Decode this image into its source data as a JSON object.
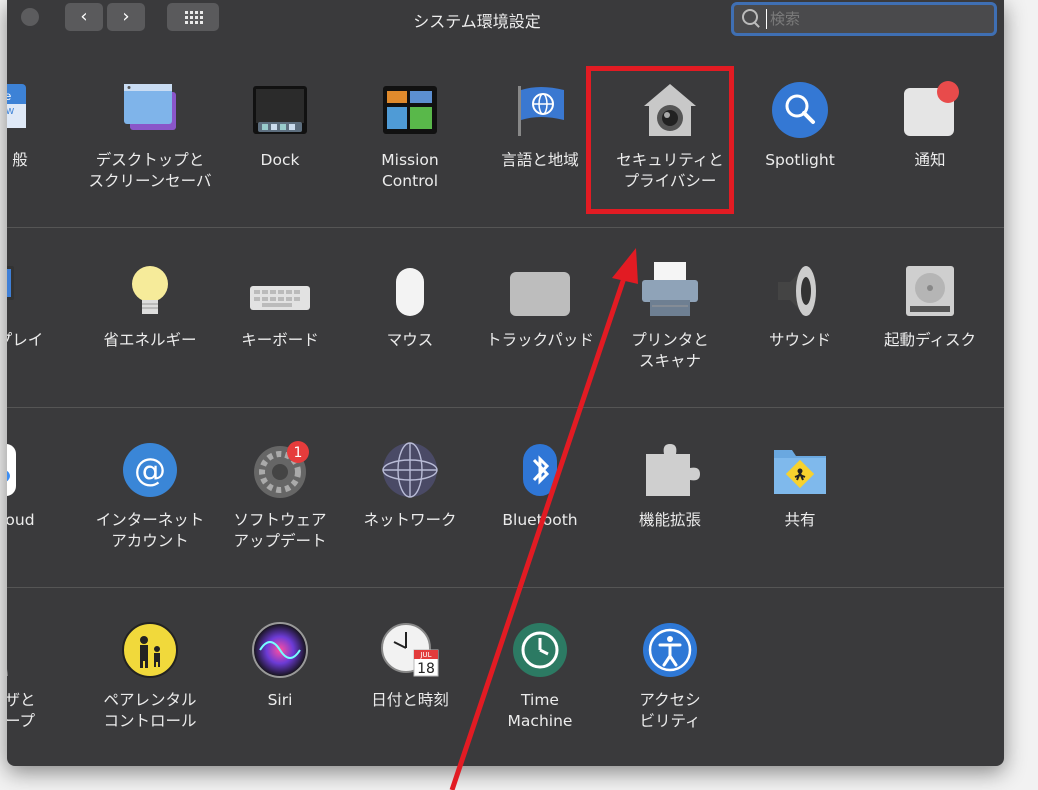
{
  "window": {
    "title": "システム環境設定"
  },
  "toolbar": {
    "back": "‹",
    "forward": "›",
    "search_placeholder": "検索"
  },
  "rows": [
    {
      "items": [
        {
          "id": "general",
          "label": "般",
          "icon": "general-icon"
        },
        {
          "id": "desktop",
          "label": "デスクトップと\nスクリーンセーバ",
          "icon": "desktop-screensaver-icon"
        },
        {
          "id": "dock",
          "label": "Dock",
          "icon": "dock-icon"
        },
        {
          "id": "mission",
          "label": "Mission\nControl",
          "icon": "mission-control-icon"
        },
        {
          "id": "language",
          "label": "言語と地域",
          "icon": "language-region-icon"
        },
        {
          "id": "security",
          "label": "セキュリティと\nプライバシー",
          "icon": "security-privacy-icon"
        },
        {
          "id": "spotlight",
          "label": "Spotlight",
          "icon": "spotlight-icon"
        },
        {
          "id": "notify",
          "label": "通知",
          "icon": "notifications-icon"
        }
      ]
    },
    {
      "items": [
        {
          "id": "display",
          "label": "プレイ",
          "icon": "displays-icon"
        },
        {
          "id": "energy",
          "label": "省エネルギー",
          "icon": "energy-saver-icon"
        },
        {
          "id": "keyboard",
          "label": "キーボード",
          "icon": "keyboard-icon"
        },
        {
          "id": "mouse",
          "label": "マウス",
          "icon": "mouse-icon"
        },
        {
          "id": "trackpad",
          "label": "トラックパッド",
          "icon": "trackpad-icon"
        },
        {
          "id": "printer",
          "label": "プリンタと\nスキャナ",
          "icon": "printer-scanner-icon"
        },
        {
          "id": "sound",
          "label": "サウンド",
          "icon": "sound-icon"
        },
        {
          "id": "startup",
          "label": "起動ディスク",
          "icon": "startup-disk-icon"
        }
      ]
    },
    {
      "items": [
        {
          "id": "icloud",
          "label": "oud",
          "icon": "icloud-icon"
        },
        {
          "id": "internet",
          "label": "インターネット\nアカウント",
          "icon": "internet-accounts-icon"
        },
        {
          "id": "update",
          "label": "ソフトウェア\nアップデート",
          "icon": "software-update-icon",
          "badge": "1"
        },
        {
          "id": "network",
          "label": "ネットワーク",
          "icon": "network-icon"
        },
        {
          "id": "bluetooth",
          "label": "Bluetooth",
          "icon": "bluetooth-icon"
        },
        {
          "id": "extensions",
          "label": "機能拡張",
          "icon": "extensions-icon"
        },
        {
          "id": "sharing",
          "label": "共有",
          "icon": "sharing-icon"
        }
      ]
    },
    {
      "items": [
        {
          "id": "users",
          "label": "ザと\nープ",
          "icon": "users-groups-icon"
        },
        {
          "id": "parental",
          "label": "ペアレンタル\nコントロール",
          "icon": "parental-controls-icon"
        },
        {
          "id": "siri",
          "label": "Siri",
          "icon": "siri-icon"
        },
        {
          "id": "datetime",
          "label": "日付と時刻",
          "icon": "date-time-icon",
          "cal_month": "JUL",
          "cal_day": "18"
        },
        {
          "id": "timemachine",
          "label": "Time\nMachine",
          "icon": "time-machine-icon"
        },
        {
          "id": "access",
          "label": "アクセシ\nビリティ",
          "icon": "accessibility-icon"
        }
      ]
    }
  ],
  "annotation": {
    "highlight_color": "#e21b23"
  }
}
